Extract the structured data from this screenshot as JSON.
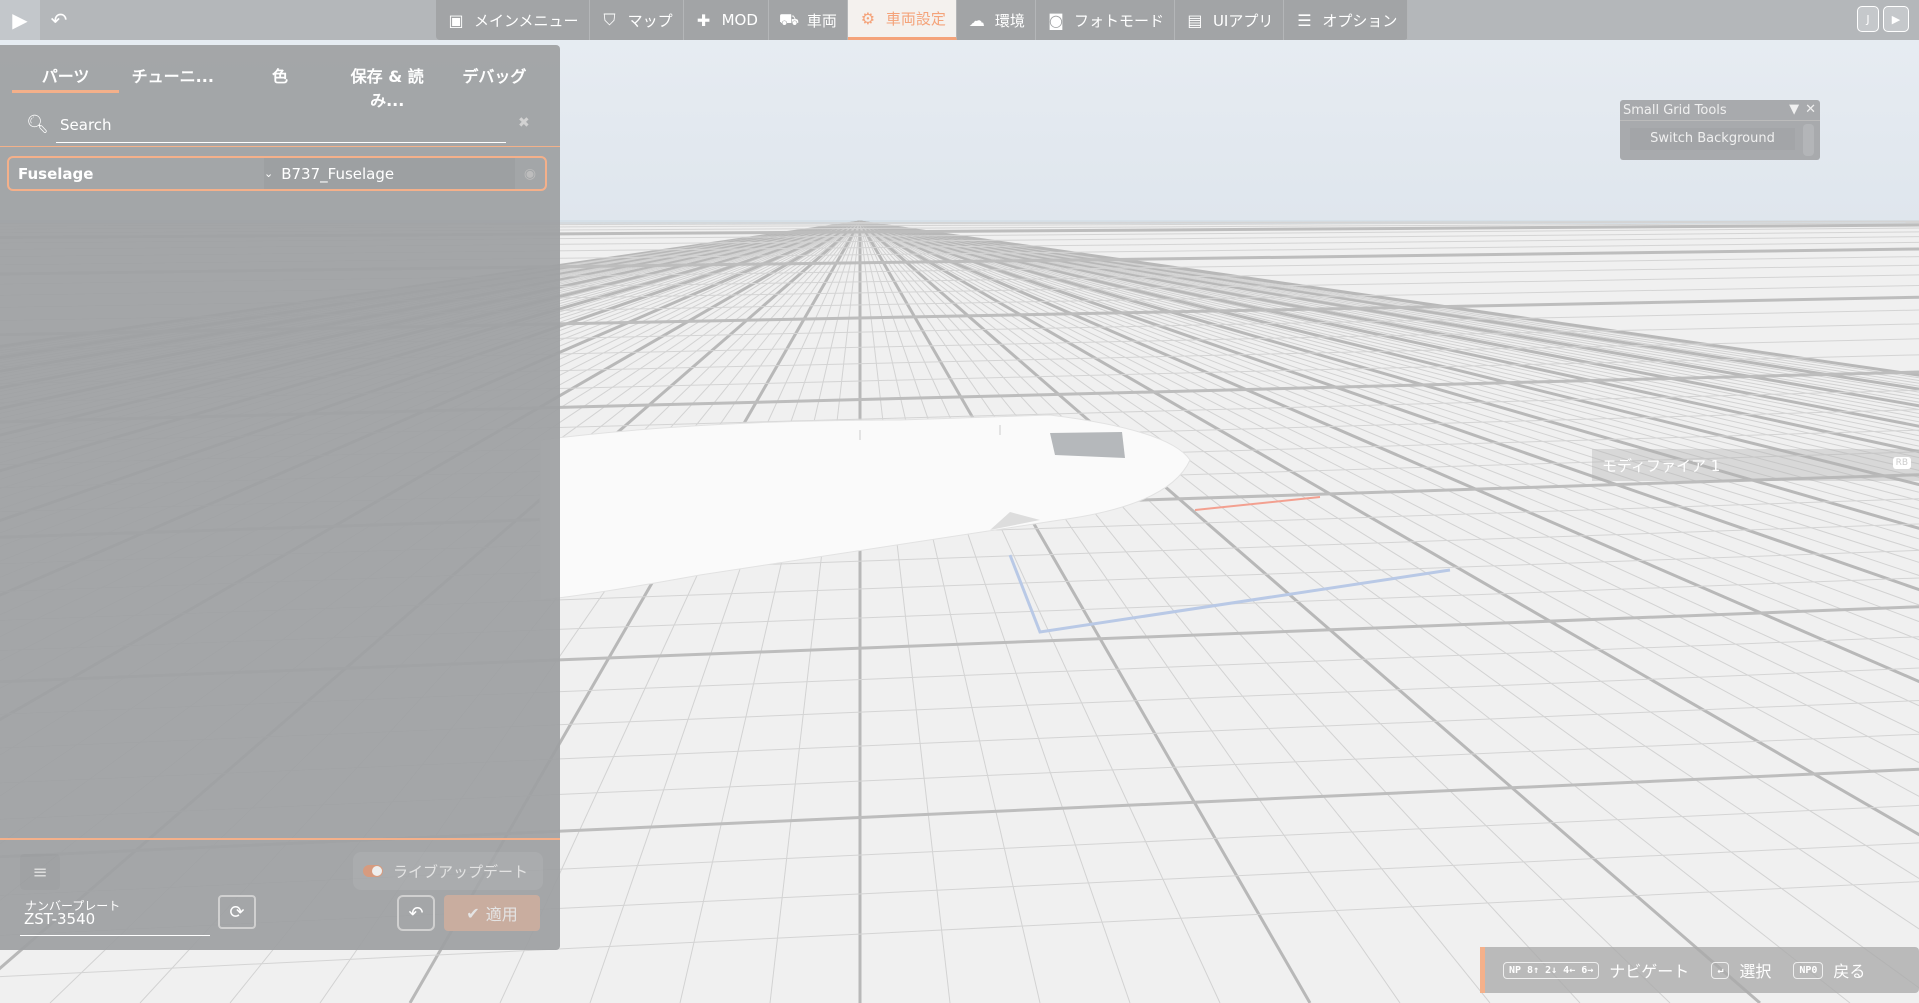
{
  "topbar": {
    "menu": [
      {
        "label": "メインメニュー",
        "icon": "main-menu-icon",
        "glyph": "▣"
      },
      {
        "label": "マップ",
        "icon": "map-icon",
        "glyph": "⛉"
      },
      {
        "label": "MOD",
        "icon": "puzzle-icon",
        "glyph": "✚"
      },
      {
        "label": "車両",
        "icon": "car-icon",
        "glyph": "⛟"
      },
      {
        "label": "車両設定",
        "icon": "engine-icon",
        "glyph": "⚙"
      },
      {
        "label": "環境",
        "icon": "weather-icon",
        "glyph": "☁"
      },
      {
        "label": "フォトモード",
        "icon": "camera-icon",
        "glyph": "◙"
      },
      {
        "label": "UIアプリ",
        "icon": "ui-apps-icon",
        "glyph": "▤"
      },
      {
        "label": "オプション",
        "icon": "options-icon",
        "glyph": "☰"
      }
    ],
    "active_index": 4,
    "right_key": "J"
  },
  "panel": {
    "tabs": [
      "パーツ",
      "チューニ...",
      "色",
      "保存 & 読み...",
      "デバッグ"
    ],
    "search_placeholder": "Search",
    "parts": [
      {
        "slot": "Fuselage",
        "value": "B737_Fuselage"
      }
    ],
    "live_update_label": "ライブアップデート",
    "plate_label": "ナンバープレート",
    "plate_value": "ZST-3540",
    "apply_label": "適用"
  },
  "grid_tools": {
    "title": "Small Grid Tools",
    "button": "Switch Background"
  },
  "modifier": {
    "label": "モディファイア 1",
    "key": "RB"
  },
  "hints": {
    "nav_key": "NP 8↑ 2↓ 4← 6→",
    "nav_label": "ナビゲート",
    "select_key": "↵",
    "select_label": "選択",
    "back_key": "NP0",
    "back_label": "戻る"
  },
  "colors": {
    "accent": "#f4a37a"
  }
}
